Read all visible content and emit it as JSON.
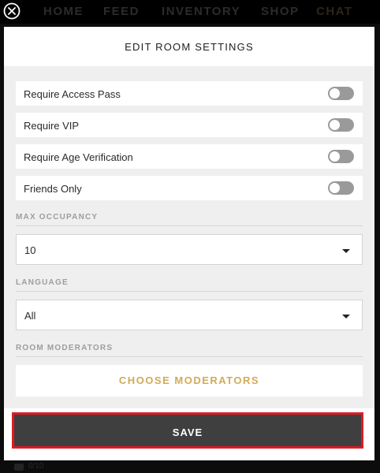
{
  "nav": {
    "items": [
      "HOME",
      "FEED",
      "INVENTORY",
      "SHOP",
      "CHAT"
    ]
  },
  "modal": {
    "title": "EDIT ROOM SETTINGS",
    "toggles": [
      {
        "label": "Require Access Pass",
        "on": false
      },
      {
        "label": "Require VIP",
        "on": false
      },
      {
        "label": "Require Age Verification",
        "on": false
      },
      {
        "label": "Friends Only",
        "on": false
      }
    ],
    "max_occupancy": {
      "label": "MAX OCCUPANCY",
      "value": "10"
    },
    "language": {
      "label": "LANGUAGE",
      "value": "All"
    },
    "moderators": {
      "label": "ROOM MODERATORS",
      "button": "CHOOSE MODERATORS"
    },
    "save_label": "SAVE"
  },
  "background": {
    "peek_text": "0/10"
  },
  "colors": {
    "accent": "#d2aa5a",
    "save_bg": "#3f3f3f",
    "highlight": "#dd1c24",
    "toggle_off": "#9a9a9a"
  }
}
